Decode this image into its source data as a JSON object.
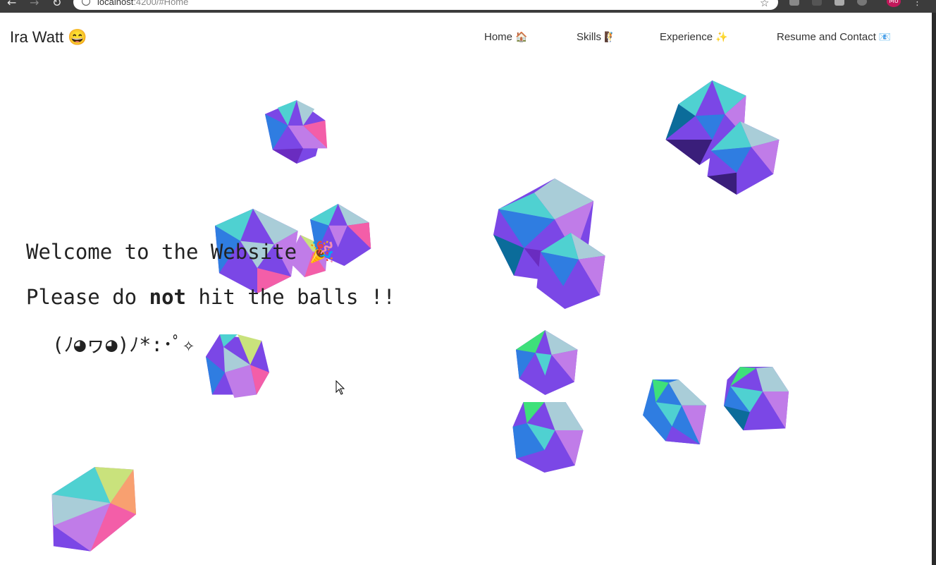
{
  "browser": {
    "url_host": "localhost",
    "url_rest": ":4200/#Home",
    "back_icon": "arrow-left",
    "forward_icon": "arrow-right",
    "reload_icon": "reload",
    "bookmark_icon": "star",
    "profile_initials": "Mo",
    "menu_icon": "kebab"
  },
  "site": {
    "brand": "Ira Watt 😄",
    "nav": [
      {
        "label": "Home",
        "emoji": "🏠"
      },
      {
        "label": "Skills",
        "emoji": "🧗"
      },
      {
        "label": "Experience",
        "emoji": "✨"
      },
      {
        "label": "Resume and Contact",
        "emoji": "📧"
      }
    ]
  },
  "hero": {
    "line1": "Welcome to the Website 🎉",
    "line2_pre": "Please do ",
    "line2_bold": "not",
    "line2_post": " hit the balls !!",
    "kaomoji": "(ﾉ◕ヮ◕)ﾉ*:･ﾟ✧"
  },
  "colors": {
    "cyan": "#4fd1d1",
    "blue": "#2f7de1",
    "violet": "#7b47e6",
    "lilac": "#c07ce8",
    "pink": "#f35ea8",
    "green": "#3ee07a",
    "lime": "#c9e27c",
    "grayblue": "#a9cdd8"
  }
}
